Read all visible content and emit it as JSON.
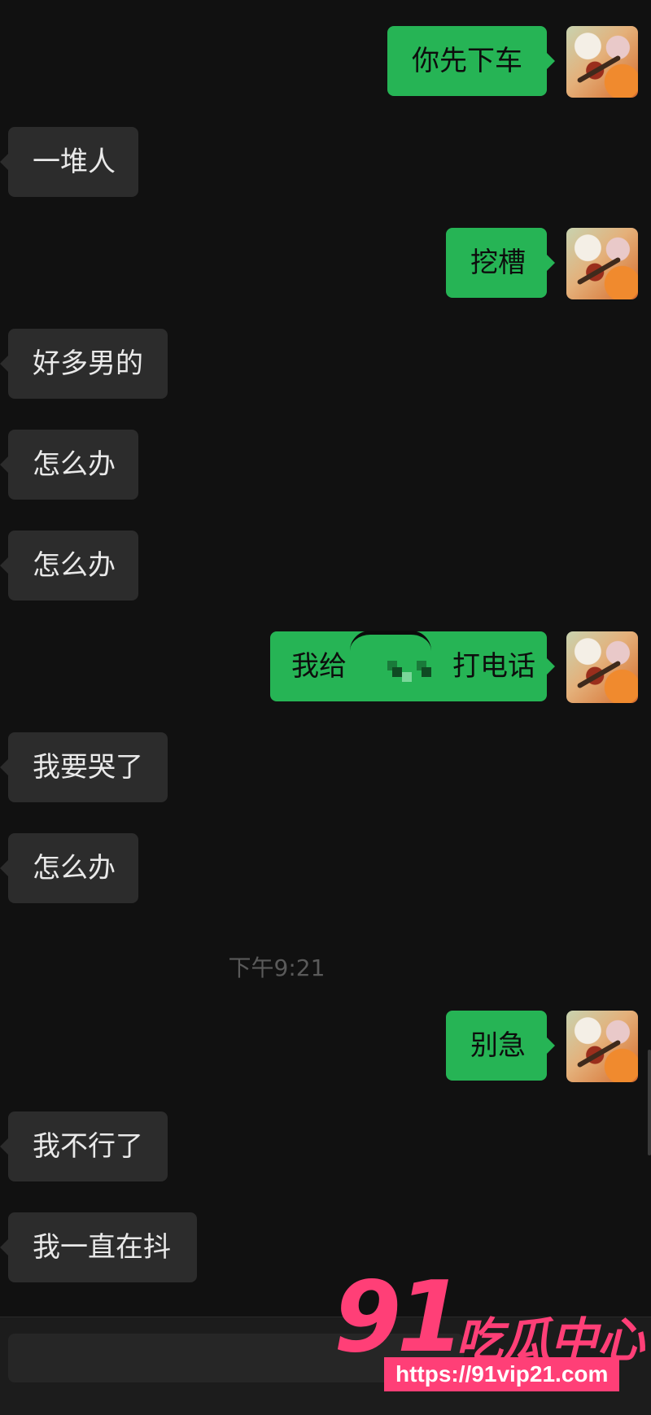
{
  "colors": {
    "background": "#111111",
    "incoming_bubble": "#2c2c2c",
    "outgoing_bubble": "#26b455",
    "watermark": "#ff3f77"
  },
  "messages": [
    {
      "side": "out",
      "text": "你先下车"
    },
    {
      "side": "in",
      "text": "一堆人"
    },
    {
      "side": "out",
      "text": "挖槽"
    },
    {
      "side": "in",
      "text": "好多男的"
    },
    {
      "side": "in",
      "text": "怎么办"
    },
    {
      "side": "in",
      "text": "怎么办"
    },
    {
      "side": "out",
      "text": "我给",
      "text_after_redaction": "打电话"
    },
    {
      "side": "in",
      "text": "我要哭了"
    },
    {
      "side": "in",
      "text": "怎么办"
    },
    {
      "side": "out",
      "text": "别急"
    },
    {
      "side": "in",
      "text": "我不行了"
    },
    {
      "side": "in",
      "text": "我一直在抖"
    }
  ],
  "timestamp": "下午9:21",
  "watermark": {
    "number": "91",
    "text": "吃瓜中心",
    "url": "https://91vip21.com"
  }
}
